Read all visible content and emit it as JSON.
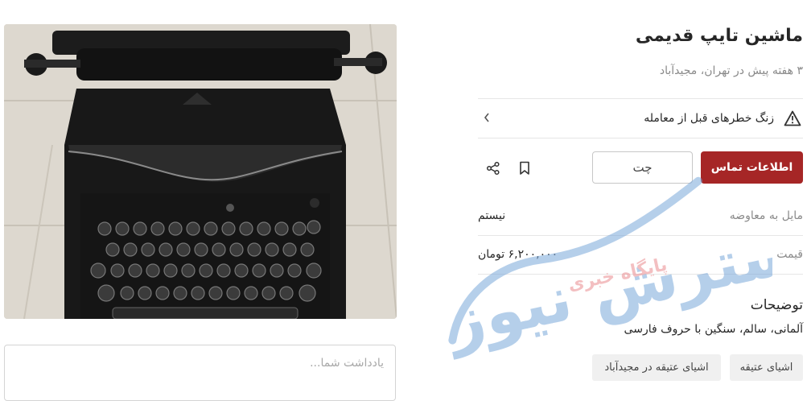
{
  "listing": {
    "title": "ماشین تایپ قدیمی",
    "subtitle": "۳ هفته پیش در تهران، مجیدآباد"
  },
  "risk_banner": {
    "label": "زنگ خطرهای قبل از معامله",
    "icon": "warning-icon"
  },
  "actions": {
    "contact_label": "اطلاعات تماس",
    "chat_label": "چت",
    "bookmark_icon": "bookmark-icon",
    "share_icon": "share-icon",
    "primary_color": "#a62626"
  },
  "attributes": [
    {
      "key": "مایل به معاوضه",
      "value": "نیستم"
    },
    {
      "key": "قیمت",
      "value": "۶,۲۰۰,۰۰۰ تومان"
    }
  ],
  "description": {
    "title": "توضیحات",
    "text": "آلمانی، سالم، سنگین با حروف فارسی"
  },
  "tags": [
    "اشیای عتیقه",
    "اشیای عتیقه در مجیدآباد"
  ],
  "note": {
    "placeholder": "یادداشت شما..."
  },
  "photo": {
    "subject": "typewriter-photo"
  },
  "watermark": {
    "main_text": "گسترش نیوز",
    "sub_text": "پایگاه خبری",
    "main_color": "#3d7ec9",
    "sub_color": "#e0474c"
  }
}
